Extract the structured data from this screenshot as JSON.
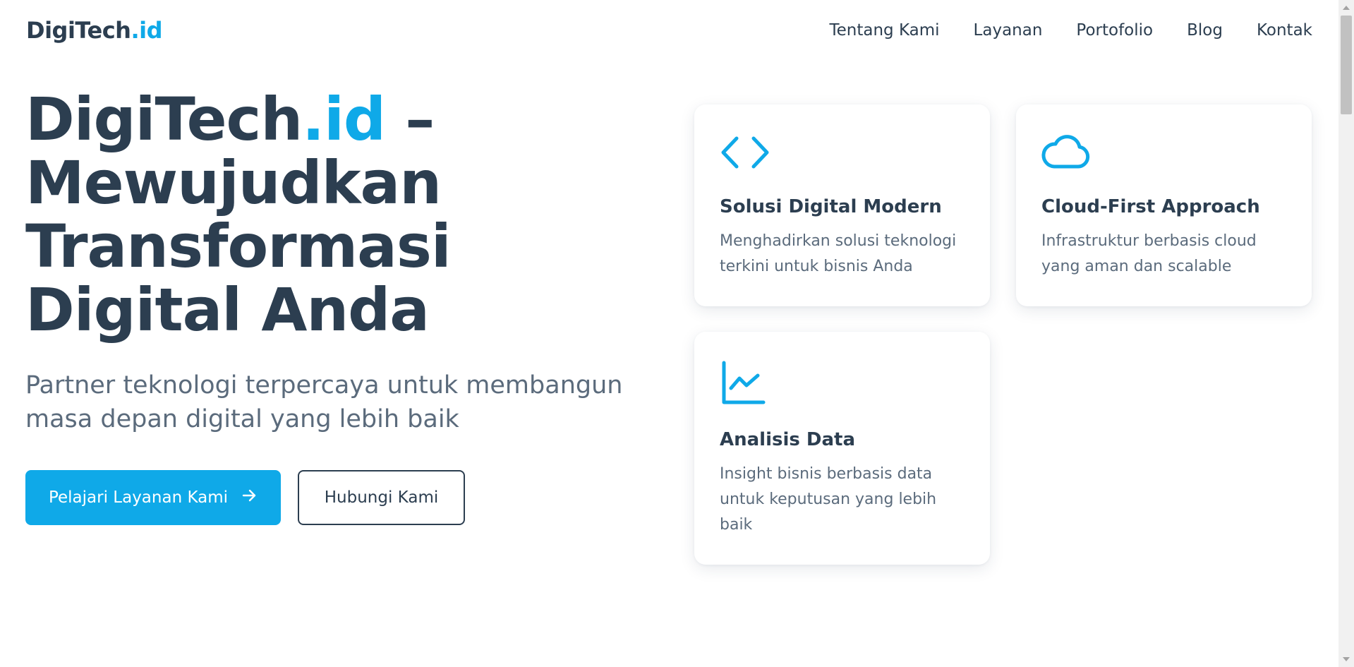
{
  "header": {
    "logo_main": "DigiTech",
    "logo_accent": ".id",
    "nav": [
      {
        "label": "Tentang Kami"
      },
      {
        "label": "Layanan"
      },
      {
        "label": "Portofolio"
      },
      {
        "label": "Blog"
      },
      {
        "label": "Kontak"
      }
    ]
  },
  "hero": {
    "title_part1": "DigiTech",
    "title_accent": ".id",
    "title_part2": " –",
    "title_line2": "Mewujudkan",
    "title_line3": "Transformasi",
    "title_line4": "Digital Anda",
    "subtitle": "Partner teknologi terpercaya untuk membangun masa depan digital yang lebih baik",
    "primary_button": "Pelajari Layanan Kami",
    "secondary_button": "Hubungi Kami"
  },
  "features": [
    {
      "icon": "code-icon",
      "title": "Solusi Digital Modern",
      "description": "Menghadirkan solusi teknologi terkini untuk bisnis Anda"
    },
    {
      "icon": "cloud-icon",
      "title": "Cloud-First Approach",
      "description": "Infrastruktur berbasis cloud yang aman dan scalable"
    },
    {
      "icon": "chart-line-icon",
      "title": "Analisis Data",
      "description": "Insight bisnis berbasis data untuk keputusan yang lebih baik"
    }
  ],
  "colors": {
    "accent": "#0fa9e8",
    "text_dark": "#2c3e50",
    "text_muted": "#5b6b7c"
  }
}
